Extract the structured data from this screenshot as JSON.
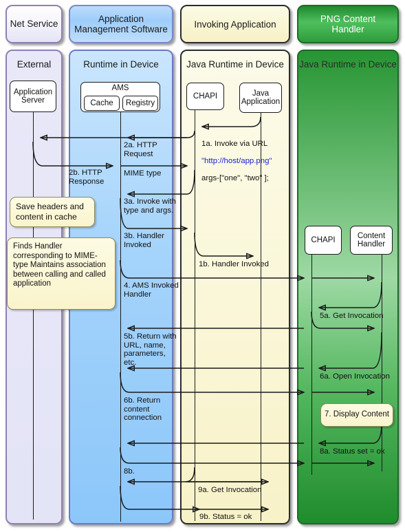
{
  "diagram": {
    "title": "CHAPI invocation sequence",
    "type": "sequence-diagram"
  },
  "headers": [
    {
      "id": "net-service",
      "label": "Net Service",
      "color": "#e4e4f6"
    },
    {
      "id": "ams-software",
      "label": "Application\nManagement Software",
      "color": "#9ecdfa"
    },
    {
      "id": "invoking-app",
      "label": "Invoking Application",
      "color": "#f9f5d2"
    },
    {
      "id": "png-handler",
      "label": "PNG Content\nHandler",
      "color": "#3aa648"
    }
  ],
  "columns": [
    {
      "id": "external",
      "title": "External"
    },
    {
      "id": "runtime",
      "title": "Runtime in Device"
    },
    {
      "id": "java-rt-inv",
      "title": "Java Runtime in Device"
    },
    {
      "id": "java-rt-png",
      "title": "Java Runtime in Device"
    }
  ],
  "actors": {
    "application_server": "Application\nServer",
    "ams": "AMS",
    "ams_cache": "Cache",
    "ams_registry": "Registry",
    "chapi_left": "CHAPI",
    "java_application": "Java\nApplication",
    "chapi_right": "CHAPI",
    "content_handler": "Content\nHandler"
  },
  "notes": [
    {
      "id": "note-cache",
      "text": "Save headers and\ncontent in cache"
    },
    {
      "id": "note-handler",
      "text": "Finds Handler corresponding\nto MIME- type\nMaintains association\nbetween calling and called\napplication"
    },
    {
      "id": "note-display",
      "text": "7. Display Content"
    }
  ],
  "messages": [
    {
      "id": "m1a",
      "num": "1a",
      "label": "1a. Invoke via URL",
      "url": "\"http://host/app.png\"",
      "tail": "args-[\"one\", \"two\" ];",
      "from": "java-application",
      "to": "chapi-left"
    },
    {
      "id": "m2a",
      "label": "2a. HTTP\nRequest",
      "from": "chapi-left",
      "to": "application-server"
    },
    {
      "id": "m2b",
      "label": "2b. HTTP\nResponse",
      "from": "application-server",
      "to": "chapi-left"
    },
    {
      "id": "mmime",
      "label": "MIME type",
      "from": "ams",
      "to": "chapi-left"
    },
    {
      "id": "m3a",
      "label": "3a. Invoke with\ntype and args.",
      "from": "chapi-left",
      "to": "ams"
    },
    {
      "id": "m3b",
      "label": "3b. Handler\nInvoked",
      "from": "ams",
      "to": "chapi-left"
    },
    {
      "id": "m1b",
      "label": "1b. Handler Invoked",
      "from": "chapi-left",
      "to": "java-application"
    },
    {
      "id": "m4",
      "label": "4. AMS Invoked\nHandler",
      "from": "ams",
      "to": "content-handler"
    },
    {
      "id": "m5a",
      "label": "5a. Get Invocation",
      "from": "content-handler",
      "to": "chapi-right"
    },
    {
      "id": "m5b",
      "label": "5b. Return with\nURL, name,\nparameters, etc.",
      "from": "chapi-right",
      "to": "ams"
    },
    {
      "id": "m6a",
      "label": "6a. Open Invocation",
      "from": "content-handler",
      "to": "chapi-right"
    },
    {
      "id": "m6b",
      "label": "6b. Return\ncontent\nconnection",
      "from": "chapi-right",
      "to": "ams"
    },
    {
      "id": "m8a",
      "label": "8a. Status set = ok",
      "from": "content-handler",
      "to": "chapi-right"
    },
    {
      "id": "m8b",
      "label": "8b.",
      "from": "chapi-right",
      "to": "ams"
    },
    {
      "id": "m9a",
      "label": "9a. Get Invocation",
      "from": "chapi-left",
      "to": "java-application"
    },
    {
      "id": "m9b",
      "label": "9b. Status = ok",
      "from": "java-application",
      "to": "chapi-left"
    }
  ]
}
